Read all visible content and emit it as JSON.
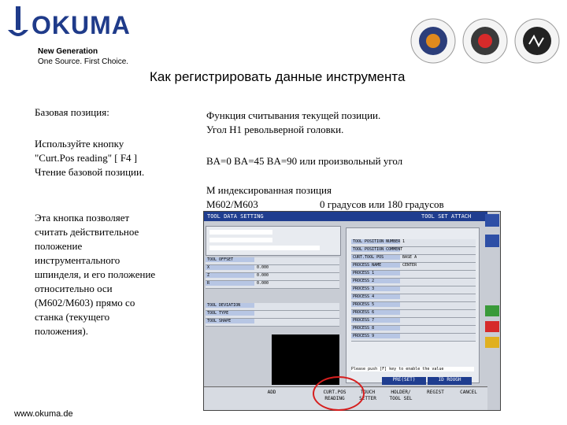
{
  "brand": {
    "logo_text": "OKUMA",
    "tagline_1": "New Generation",
    "tagline_2": "One Source. First Choice.",
    "footer_url": "www.okuma.de"
  },
  "page_title": "Как регистрировать данные инструмента",
  "left_column": {
    "block_1": "Базовая позиция:",
    "block_2": "Используйте кнопку\n \"Curt.Pos reading\" [ F4 ]\nЧтение базовой позиции.",
    "block_3": "Эта кнопка позволяет\nсчитать действительное\nположение\nинструментального\nшпинделя, и его положение\nотносительно оси\n(M602/M603) прямо со\nстанка (текущего\nположения)."
  },
  "right_column": {
    "block_1": "Функция считывания текущей позиции.\nУгол Н1 револьверной головки.",
    "block_2": "BA=0 BA=45 BA=90 или произвольный угол",
    "block_3": "М индексированная позиция",
    "block_4a": "M602/M603",
    "block_4b": "0 градусов или 180 градусов"
  },
  "screen": {
    "header_title": "TOOL DATA SETTING",
    "header_tab": "TOOL SET ATTACH",
    "fkeys": [
      {
        "label": "ADD"
      },
      {
        "label": "CURT.POS\nREADING"
      },
      {
        "label": "TOUCH\nSETTER"
      },
      {
        "label": "HOLDER/\nTOOL SEL"
      },
      {
        "label": "REGIST"
      },
      {
        "label": "CANCEL"
      }
    ],
    "upper_keys": [
      {
        "label": "PRE(SET)"
      },
      {
        "label": "ID ROUGH"
      }
    ],
    "table_rows": [
      {
        "label": "TOOL POSITION NUMBER",
        "value": "1"
      },
      {
        "label": "TOOL POSITION COMMENT",
        "value": ""
      },
      {
        "label": "CURT.TOOL POS",
        "value": "BASE A"
      },
      {
        "label": "PROCESS NAME",
        "value": "CENTER"
      },
      {
        "label": "PROCESS 1",
        "value": ""
      },
      {
        "label": "PROCESS 2",
        "value": ""
      },
      {
        "label": "PROCESS 3",
        "value": ""
      },
      {
        "label": "PROCESS 4",
        "value": ""
      },
      {
        "label": "PROCESS 5",
        "value": ""
      },
      {
        "label": "PROCESS 6",
        "value": ""
      },
      {
        "label": "PROCESS 7",
        "value": ""
      },
      {
        "label": "PROCESS 8",
        "value": ""
      },
      {
        "label": "PROCESS 9",
        "value": ""
      }
    ],
    "status_msg": "Please push [F] key to enable the value",
    "left_panel_rows": [
      {
        "label": "TOOL OFFSET",
        "value": ""
      },
      {
        "label": "X",
        "value": "0.000"
      },
      {
        "label": "Z",
        "value": "0.000"
      },
      {
        "label": "R",
        "value": "0.000"
      },
      {
        "label": "TOOL DEVIATION",
        "value": ""
      },
      {
        "label": "TOOL TYPE",
        "value": ""
      },
      {
        "label": "TOOL SHAPE",
        "value": ""
      }
    ]
  },
  "colors": {
    "brand_blue": "#1f3b8a",
    "screen_header": "#1f3d8f",
    "highlight": "#d61f1f"
  }
}
